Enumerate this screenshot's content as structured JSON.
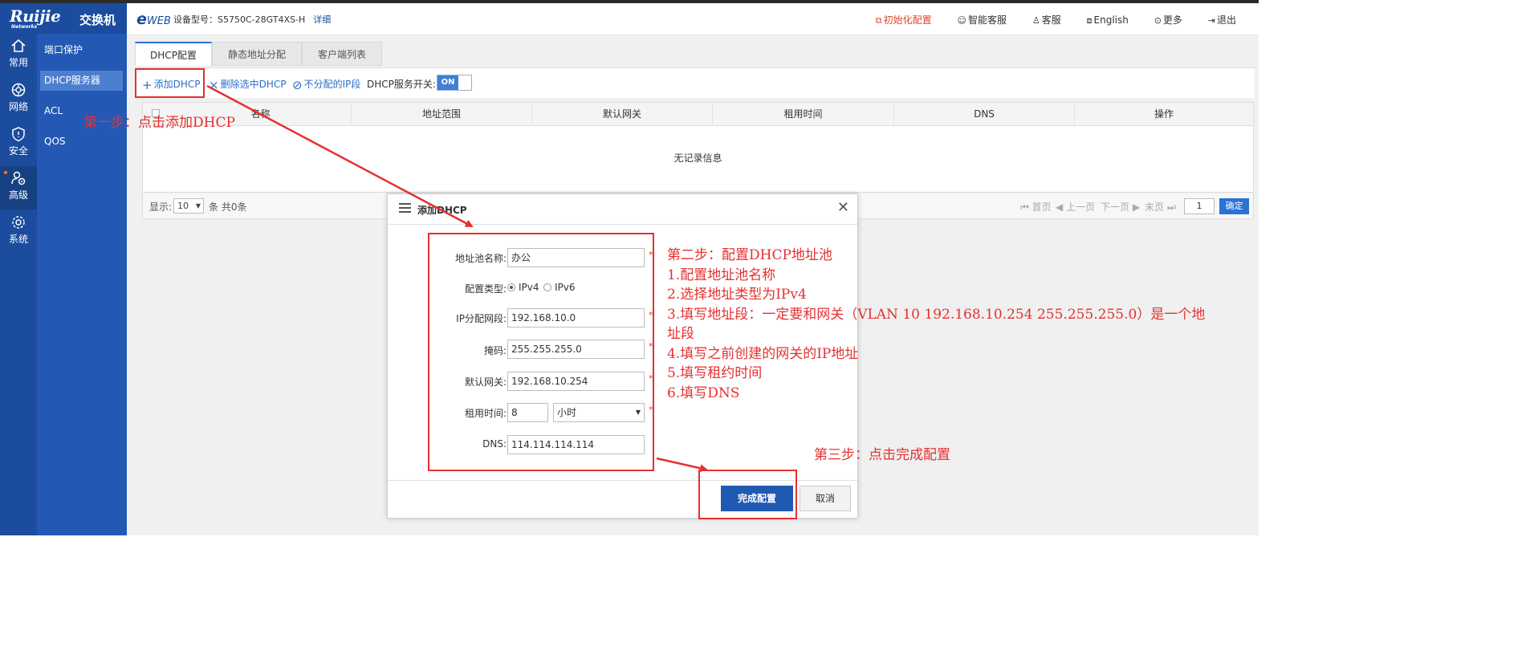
{
  "brand": {
    "logo": "Ruijie",
    "logo_sub": "Networks",
    "product": "交换机"
  },
  "nav": [
    {
      "label": "常用",
      "icon": "home-icon"
    },
    {
      "label": "网络",
      "icon": "network-icon"
    },
    {
      "label": "安全",
      "icon": "shield-icon"
    },
    {
      "label": "高级",
      "icon": "advanced-icon"
    },
    {
      "label": "系统",
      "icon": "gear-icon"
    }
  ],
  "subnav": [
    "端口保护",
    "DHCP服务器",
    "ACL",
    "QOS"
  ],
  "header": {
    "eweb_e": "e",
    "eweb_text": "WEB",
    "device_label": "设备型号：S5750C-28GT4XS-H",
    "detail": "详细",
    "menu": [
      "初始化配置",
      "智能客服",
      "客服",
      "English",
      "更多",
      "退出"
    ]
  },
  "tabs": [
    "DHCP配置",
    "静态地址分配",
    "客户端列表"
  ],
  "toolbar": {
    "add": "添加DHCP",
    "delete": "删除选中DHCP",
    "exclude": "不分配的IP段",
    "service_label": "DHCP服务开关:",
    "toggle": "ON"
  },
  "table": {
    "columns": [
      "名称",
      "地址范围",
      "默认网关",
      "租用时间",
      "DNS",
      "操作"
    ],
    "empty": "无记录信息"
  },
  "pager": {
    "show_label": "显示:",
    "page_size": "10",
    "total": "条 共0条",
    "first": "首页",
    "prev": "上一页",
    "next": "下一页",
    "last": "末页",
    "page": "1",
    "ok": "确定"
  },
  "dialog": {
    "title": "添加DHCP",
    "fields": {
      "pool_name": {
        "label": "地址池名称:",
        "value": "办公"
      },
      "type": {
        "label": "配置类型:",
        "options": [
          "IPv4",
          "IPv6"
        ],
        "selected": "IPv4"
      },
      "ip_range": {
        "label": "IP分配网段:",
        "value": "192.168.10.0"
      },
      "mask": {
        "label": "掩码:",
        "value": "255.255.255.0"
      },
      "gateway": {
        "label": "默认网关:",
        "value": "192.168.10.254"
      },
      "lease": {
        "label": "租用时间:",
        "value": "8",
        "unit": "小时"
      },
      "dns": {
        "label": "DNS:",
        "value": "114.114.114.114"
      }
    },
    "required_mark": "*",
    "ok": "完成配置",
    "cancel": "取消"
  },
  "annotations": {
    "step1": "第一步：点击添加DHCP",
    "step2_lines": [
      "第二步：配置DHCP地址池",
      "1.配置地址池名称",
      "2.选择地址类型为IPv4",
      "3.填写地址段：一定要和网关（VLAN 10 192.168.10.254 255.255.255.0）是一个地",
      "址段",
      "4.填写之前创建的网关的IP地址",
      "5.填写租约时间",
      "6.填写DNS"
    ],
    "step3": "第三步：点击完成配置",
    "color": "#e53030"
  },
  "colors": {
    "nav_bg": "#1b4c9e",
    "subnav_bg": "#2359b4",
    "accent": "#2b72d6",
    "primary_btn": "#2059b2"
  }
}
